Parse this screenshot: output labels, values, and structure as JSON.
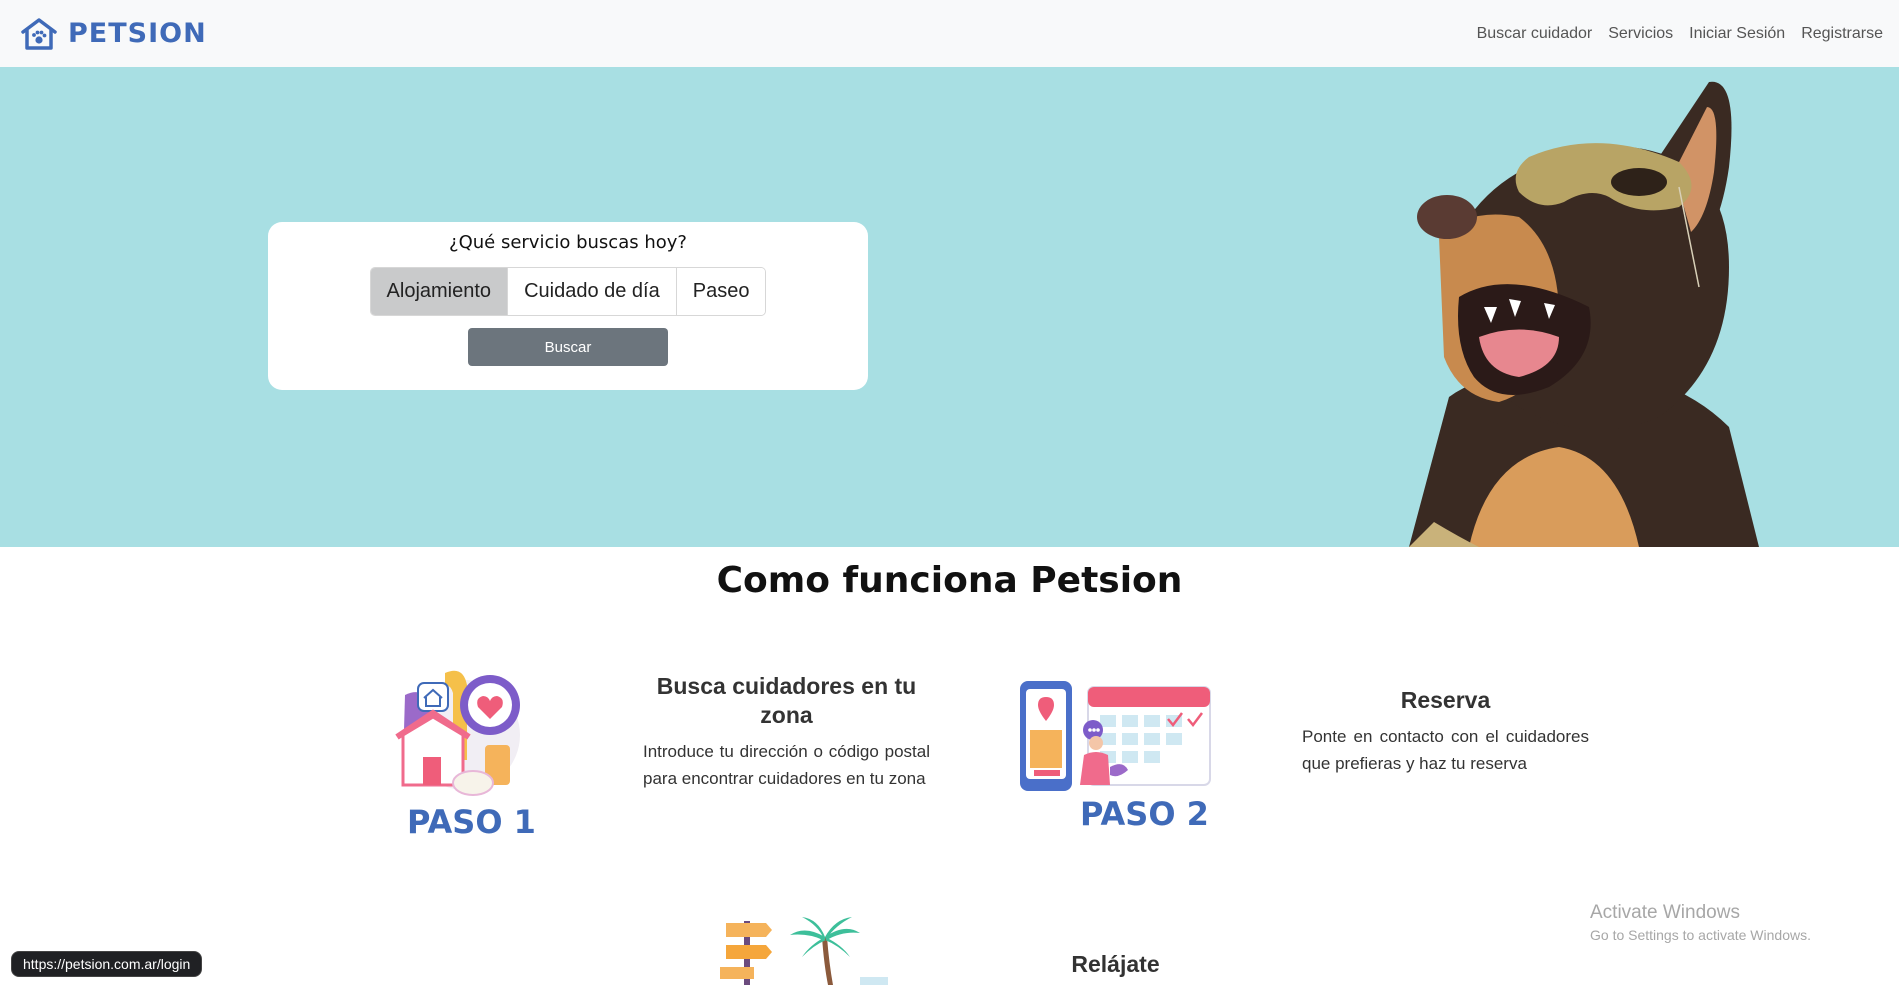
{
  "brand": {
    "name": "PETSION",
    "color": "#3f6ab8",
    "icon": "house-paw-logo"
  },
  "nav": {
    "links": [
      {
        "label": "Buscar cuidador"
      },
      {
        "label": "Servicios"
      },
      {
        "label": "Iniciar Sesión"
      },
      {
        "label": "Registrarse"
      }
    ]
  },
  "hero": {
    "background": "#a8dfe3",
    "search": {
      "title": "¿Qué servicio buscas hoy?",
      "options": [
        "Alojamiento",
        "Cuidado de día",
        "Paseo"
      ],
      "selected": "Alojamiento",
      "button_label": "Buscar"
    }
  },
  "how_it_works": {
    "title": "Como funciona Petsion",
    "steps": [
      {
        "badge": "PASO 1",
        "heading": "Busca cuidadores en tu zona",
        "description": "Introduce tu dirección o código postal para encontrar cuidadores en tu zona"
      },
      {
        "badge": "PASO 2",
        "heading": "Reserva",
        "description": "Ponte en contacto con el cuidadores que prefieras y haz tu reserva"
      },
      {
        "badge": "",
        "heading": "Relájate",
        "description": ""
      }
    ]
  },
  "status_bar": {
    "url": "https://petsion.com.ar/login"
  },
  "windows_watermark": {
    "title": "Activate Windows",
    "subtitle": "Go to Settings to activate Windows."
  }
}
